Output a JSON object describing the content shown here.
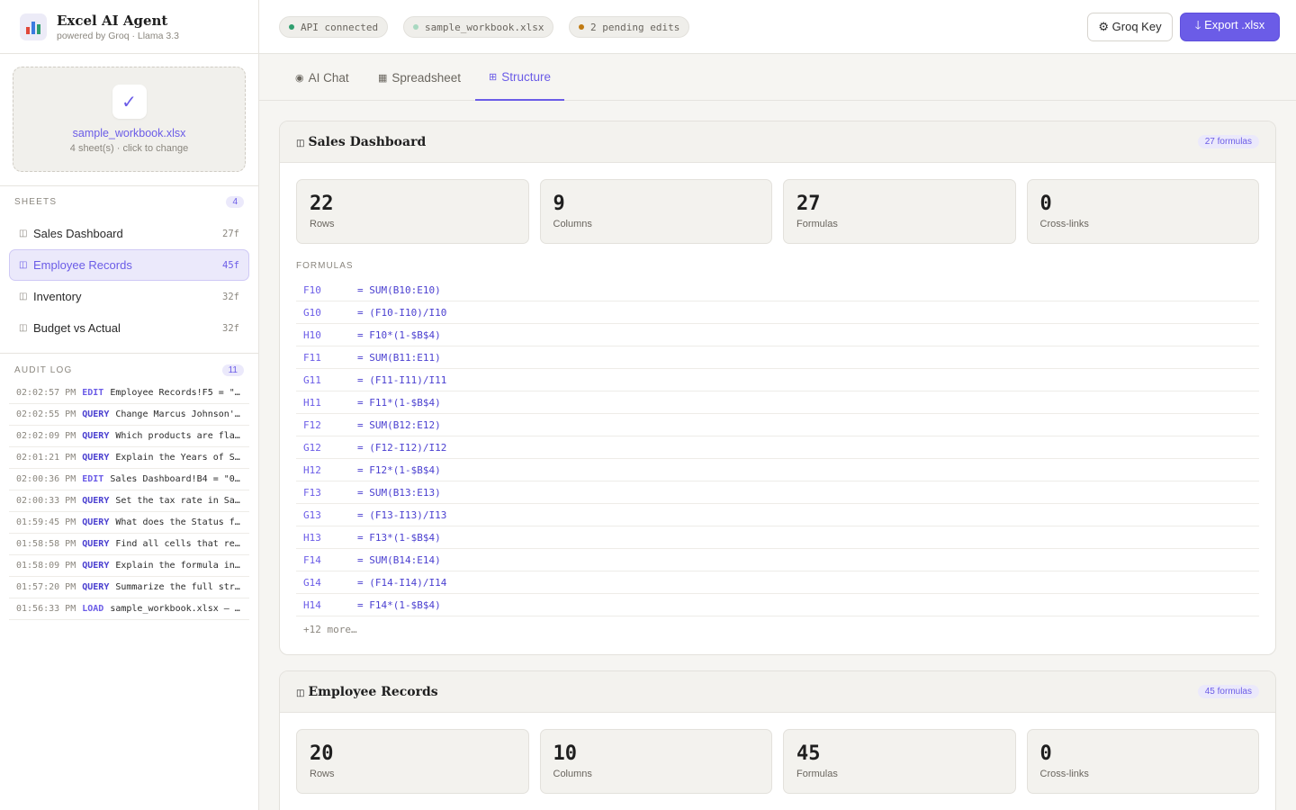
{
  "app": {
    "title": "Excel AI Agent",
    "subtitle": "powered by Groq · Llama 3.3"
  },
  "upload": {
    "filename": "sample_workbook.xlsx",
    "hint": "4 sheet(s) · click to change",
    "check": "✓"
  },
  "sheets_section": {
    "title": "SHEETS",
    "count": "4"
  },
  "sheets": [
    {
      "name": "Sales Dashboard",
      "count": "27f"
    },
    {
      "name": "Employee Records",
      "count": "45f"
    },
    {
      "name": "Inventory",
      "count": "32f"
    },
    {
      "name": "Budget vs Actual",
      "count": "32f"
    }
  ],
  "audit_section": {
    "title": "AUDIT LOG",
    "count": "11"
  },
  "audit_log": [
    {
      "time": "02:02:57 PM",
      "type": "EDIT",
      "msg": "Employee Records!F5 = \"…"
    },
    {
      "time": "02:02:55 PM",
      "type": "QUERY",
      "msg": "Change Marcus Johnson'…"
    },
    {
      "time": "02:02:09 PM",
      "type": "QUERY",
      "msg": "Which products are fla…"
    },
    {
      "time": "02:01:21 PM",
      "type": "QUERY",
      "msg": "Explain the Years of S…"
    },
    {
      "time": "02:00:36 PM",
      "type": "EDIT",
      "msg": "Sales Dashboard!B4 = \"0…"
    },
    {
      "time": "02:00:33 PM",
      "type": "QUERY",
      "msg": "Set the tax rate in Sa…"
    },
    {
      "time": "01:59:45 PM",
      "type": "QUERY",
      "msg": "What does the Status f…"
    },
    {
      "time": "01:58:58 PM",
      "type": "QUERY",
      "msg": "Find all cells that re…"
    },
    {
      "time": "01:58:09 PM",
      "type": "QUERY",
      "msg": "Explain the formula in…"
    },
    {
      "time": "01:57:20 PM",
      "type": "QUERY",
      "msg": "Summarize the full str…"
    },
    {
      "time": "01:56:33 PM",
      "type": "LOAD",
      "msg": "sample_workbook.xlsx — …"
    }
  ],
  "status": {
    "api": "API connected",
    "file": "sample_workbook.xlsx",
    "pending": "2 pending edits"
  },
  "buttons": {
    "key": "⚙ Groq Key",
    "export": "🡓 Export .xlsx"
  },
  "tabs": [
    {
      "icon": "◉",
      "label": "AI Chat"
    },
    {
      "icon": "▦",
      "label": "Spreadsheet"
    },
    {
      "icon": "⊞",
      "label": "Structure"
    }
  ],
  "cards": [
    {
      "title": "Sales Dashboard",
      "badge": "27 formulas",
      "stats": [
        {
          "value": "22",
          "label": "Rows"
        },
        {
          "value": "9",
          "label": "Columns"
        },
        {
          "value": "27",
          "label": "Formulas"
        },
        {
          "value": "0",
          "label": "Cross-links"
        }
      ],
      "formulas_label": "FORMULAS",
      "formulas": [
        {
          "cell": "F10",
          "expr": "= SUM(B10:E10)"
        },
        {
          "cell": "G10",
          "expr": "= (F10-I10)/I10"
        },
        {
          "cell": "H10",
          "expr": "= F10*(1-$B$4)"
        },
        {
          "cell": "F11",
          "expr": "= SUM(B11:E11)"
        },
        {
          "cell": "G11",
          "expr": "= (F11-I11)/I11"
        },
        {
          "cell": "H11",
          "expr": "= F11*(1-$B$4)"
        },
        {
          "cell": "F12",
          "expr": "= SUM(B12:E12)"
        },
        {
          "cell": "G12",
          "expr": "= (F12-I12)/I12"
        },
        {
          "cell": "H12",
          "expr": "= F12*(1-$B$4)"
        },
        {
          "cell": "F13",
          "expr": "= SUM(B13:E13)"
        },
        {
          "cell": "G13",
          "expr": "= (F13-I13)/I13"
        },
        {
          "cell": "H13",
          "expr": "= F13*(1-$B$4)"
        },
        {
          "cell": "F14",
          "expr": "= SUM(B14:E14)"
        },
        {
          "cell": "G14",
          "expr": "= (F14-I14)/I14"
        },
        {
          "cell": "H14",
          "expr": "= F14*(1-$B$4)"
        }
      ],
      "more": "+12 more…"
    },
    {
      "title": "Employee Records",
      "badge": "45 formulas",
      "stats": [
        {
          "value": "20",
          "label": "Rows"
        },
        {
          "value": "10",
          "label": "Columns"
        },
        {
          "value": "45",
          "label": "Formulas"
        },
        {
          "value": "0",
          "label": "Cross-links"
        }
      ]
    }
  ],
  "colors": {
    "accent": "#6b5ce7",
    "status_green": "#2f9e6e",
    "status_amber": "#c07a12"
  }
}
